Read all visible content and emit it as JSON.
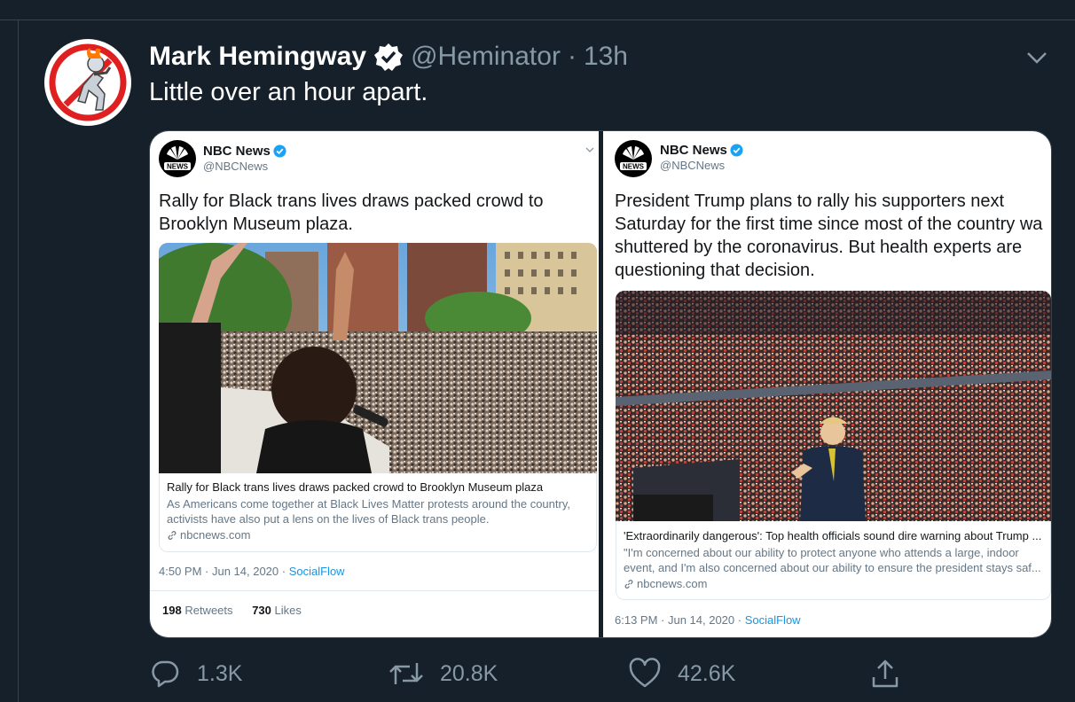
{
  "tweet": {
    "author_name": "Mark Hemingway",
    "handle": "@Heminator",
    "separator": "·",
    "time": "13h",
    "text": "Little over an hour apart."
  },
  "embeds": [
    {
      "account_name": "NBC News",
      "account_handle": "@NBCNews",
      "text_lines": [
        "Rally for Black trans lives draws packed crowd to",
        "Brooklyn Museum plaza."
      ],
      "card_title": "Rally for Black trans lives draws packed crowd to Brooklyn Museum plaza",
      "card_desc_lines": [
        "As Americans come together at Black Lives Matter protests around the country,",
        "activists have also put a lens on the lives of Black trans people."
      ],
      "card_domain": "nbcnews.com",
      "timestamp": "4:50 PM · Jun 14, 2020 · ",
      "source": "SocialFlow",
      "retweets_count": "198",
      "retweets_label": "Retweets",
      "likes_count": "730",
      "likes_label": "Likes"
    },
    {
      "account_name": "NBC News",
      "account_handle": "@NBCNews",
      "text_lines": [
        "President Trump plans to rally his supporters next",
        "Saturday for the first time since most of the country wa",
        "shuttered by the coronavirus. But health experts are",
        "questioning that decision."
      ],
      "card_title": "'Extraordinarily dangerous': Top health officials sound dire warning about Trump ...",
      "card_desc_lines": [
        "\"I'm concerned about our ability to protect anyone who attends a large, indoor",
        "event, and I'm also concerned about our ability to ensure the president stays saf..."
      ],
      "card_domain": "nbcnews.com",
      "timestamp": "6:13 PM · Jun 14, 2020 · ",
      "source": "SocialFlow"
    }
  ],
  "actions": {
    "replies": "1.3K",
    "retweets": "20.8K",
    "likes": "42.6K"
  },
  "colors": {
    "background": "#15202b",
    "muted": "#8899a6",
    "link_blue": "#1b95e0",
    "verified_blue": "#1da1f2"
  },
  "icons": [
    "avatar",
    "verified-icon",
    "chevron-down-icon",
    "nbc-peacock-logo",
    "link-icon",
    "reply-icon",
    "retweet-icon",
    "like-icon",
    "share-icon"
  ]
}
